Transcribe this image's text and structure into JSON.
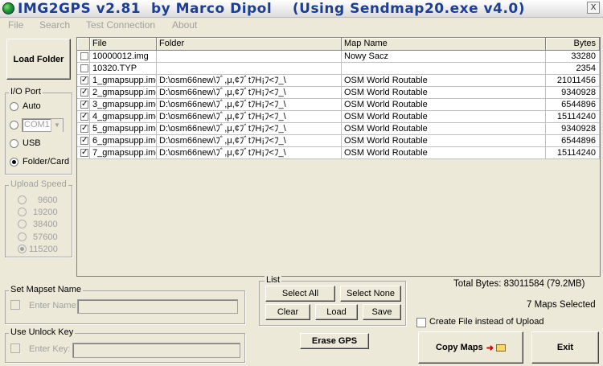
{
  "window": {
    "title": "IMG2GPS v2.81  by Marco Dipol    (Using Sendmap20.exe v4.0)",
    "close_glyph": "X"
  },
  "menu": [
    {
      "label": "File"
    },
    {
      "label": "Search"
    },
    {
      "label": "Test Connection"
    },
    {
      "label": "About"
    }
  ],
  "left": {
    "load_folder_label": "Load Folder",
    "io_port": {
      "title": "I/O Port",
      "auto_label": "Auto",
      "com_value": "COM1",
      "usb_label": "USB",
      "folder_card_label": "Folder/Card",
      "selected": "Folder/Card"
    },
    "upload_speed": {
      "title": "Upload Speed",
      "options": [
        "9600",
        "19200",
        "38400",
        "57600",
        "115200"
      ],
      "selected": "115200"
    }
  },
  "table": {
    "headers": {
      "file": "File",
      "folder": "Folder",
      "map_name": "Map Name",
      "bytes": "Bytes"
    },
    "rows": [
      {
        "checked": false,
        "file": "10000012.img",
        "folder": "",
        "map_name": "Nowy Sacz",
        "bytes": "33280"
      },
      {
        "checked": false,
        "file": "10320.TYP",
        "folder": "",
        "map_name": "",
        "bytes": "2354"
      },
      {
        "checked": true,
        "file": "1_gmapsupp.img",
        "folder": "D:\\osm66new\\ﾌﾞ,μ,¢ﾌﾞtﾌH¡ﾌ<ﾌ_\\",
        "map_name": "OSM World Routable",
        "bytes": "21011456"
      },
      {
        "checked": true,
        "file": "2_gmapsupp.img",
        "folder": "D:\\osm66new\\ﾌﾞ,μ,¢ﾌﾞtﾌH¡ﾌ<ﾌ_\\",
        "map_name": "OSM World Routable",
        "bytes": "9340928"
      },
      {
        "checked": true,
        "file": "3_gmapsupp.img",
        "folder": "D:\\osm66new\\ﾌﾞ,μ,¢ﾌﾞtﾌH¡ﾌ<ﾌ_\\",
        "map_name": "OSM World Routable",
        "bytes": "6544896"
      },
      {
        "checked": true,
        "file": "4_gmapsupp.img",
        "folder": "D:\\osm66new\\ﾌﾞ,μ,¢ﾌﾞtﾌH¡ﾌ<ﾌ_\\",
        "map_name": "OSM World Routable",
        "bytes": "15114240"
      },
      {
        "checked": true,
        "file": "5_gmapsupp.img",
        "folder": "D:\\osm66new\\ﾌﾞ,μ,¢ﾌﾞtﾌH¡ﾌ<ﾌ_\\",
        "map_name": "OSM World Routable",
        "bytes": "9340928"
      },
      {
        "checked": true,
        "file": "6_gmapsupp.img",
        "folder": "D:\\osm66new\\ﾌﾞ,μ,¢ﾌﾞtﾌH¡ﾌ<ﾌ_\\",
        "map_name": "OSM World Routable",
        "bytes": "6544896"
      },
      {
        "checked": true,
        "file": "7_gmapsupp.img",
        "folder": "D:\\osm66new\\ﾌﾞ,μ,¢ﾌﾞtﾌH¡ﾌ<ﾌ_\\",
        "map_name": "OSM World Routable",
        "bytes": "15114240"
      }
    ]
  },
  "mapset": {
    "title": "Set Mapset Name",
    "label": "Enter Name:",
    "value": ""
  },
  "unlock": {
    "title": "Use Unlock Key",
    "label": "Enter Key:",
    "value": ""
  },
  "list_group": {
    "title": "List",
    "select_all": "Select All",
    "select_none": "Select None",
    "clear": "Clear",
    "load": "Load",
    "save": "Save"
  },
  "erase_gps_label": "Erase GPS",
  "status": {
    "total_bytes": "Total Bytes: 83011584 (79.2MB)",
    "maps_selected": "7 Maps Selected"
  },
  "create_file_label": "Create File instead of Upload",
  "copy_maps_label": "Copy Maps",
  "exit_label": "Exit",
  "colors": {
    "title_text": "#1c3f94",
    "window_bg": "#ece9d8"
  }
}
